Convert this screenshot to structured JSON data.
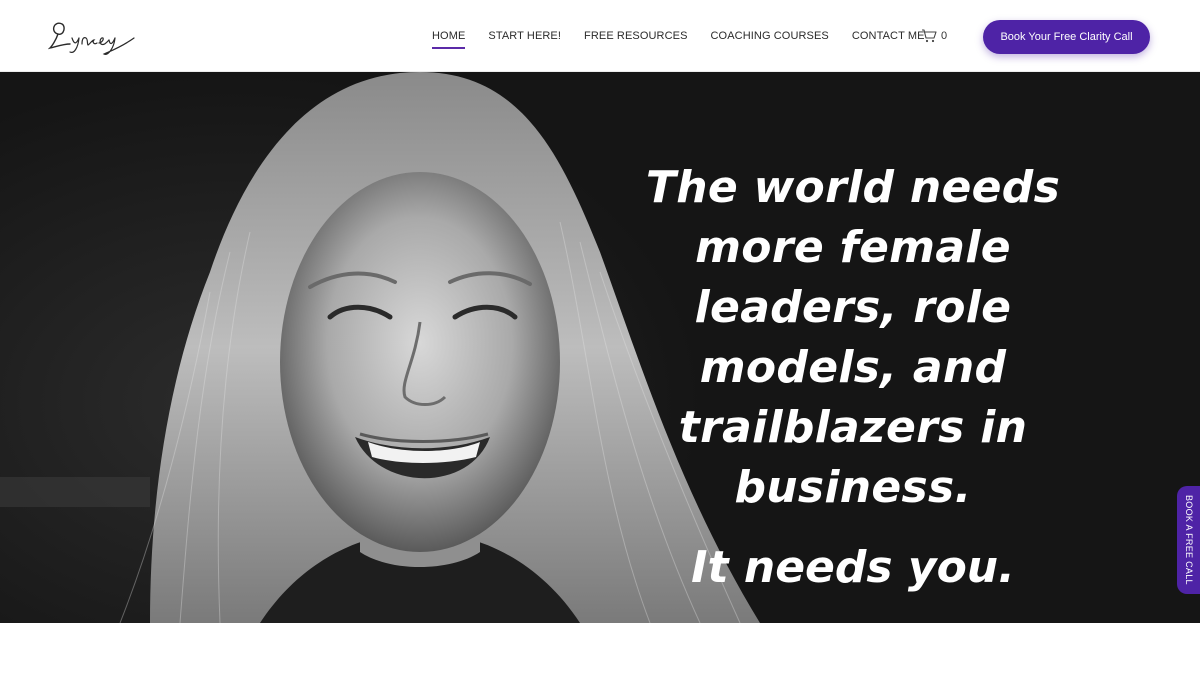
{
  "header": {
    "logo_text": "Lynsey",
    "nav": [
      {
        "label": "HOME",
        "active": true
      },
      {
        "label": "START HERE!",
        "active": false
      },
      {
        "label": "FREE RESOURCES",
        "active": false
      },
      {
        "label": "COACHING COURSES",
        "active": false
      },
      {
        "label": "CONTACT ME",
        "active": false
      }
    ],
    "cart_icon": "cart-icon",
    "cart_count": "0",
    "cta_label": "Book Your Free Clarity Call"
  },
  "hero": {
    "headline": "The world needs more female leaders, role models, and trailblazers in business.",
    "tagline": "It needs you."
  },
  "side_tab": {
    "label": "BOOK A FREE CALL"
  },
  "colors": {
    "accent": "#4e23a6",
    "hero_bg": "#151515",
    "text_dark": "#2b2b2b"
  }
}
